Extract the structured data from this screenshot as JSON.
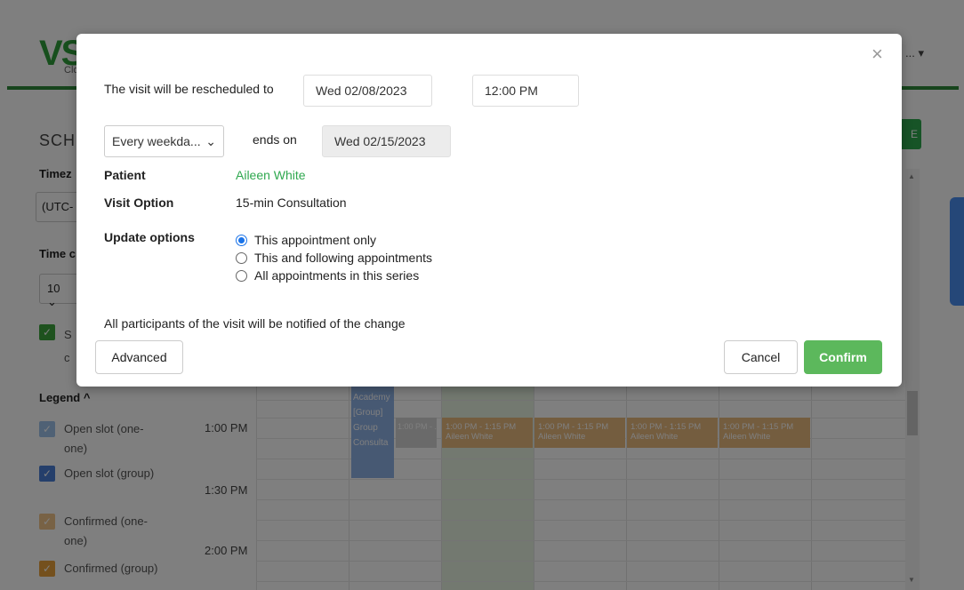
{
  "app": {
    "logo": "VS",
    "logo_sub": "Clou",
    "user_menu": "... ▾",
    "schedule_title": "SCHI",
    "new_button": "E",
    "timezone_label": "Timez",
    "timezone_value": "(UTC-",
    "time_label": "Time c",
    "time_value": "10 ⌄",
    "show_label_line1": "S",
    "show_label_line2": "c",
    "legend_title": "Legend ^",
    "legend": [
      {
        "label": "Open slot (one-one)",
        "color": "#9fc3ea"
      },
      {
        "label": "Open slot (group)",
        "color": "#4a7fd6"
      },
      {
        "label": "Confirmed (one-one)",
        "color": "#f0c48a"
      },
      {
        "label": "Confirmed (group)",
        "color": "#e8a13b"
      }
    ],
    "times": [
      "1:00 PM",
      "1:30 PM",
      "2:00 PM"
    ],
    "group_block": "VSee Academy [Group] Group Consulta",
    "grey_slot": "1:00 PM - ...",
    "appointments": [
      {
        "time": "1:00 PM - 1:15 PM",
        "name": "Aileen White"
      },
      {
        "time": "1:00 PM - 1:15 PM",
        "name": "Aileen White"
      },
      {
        "time": "1:00 PM - 1:15 PM",
        "name": "Aileen White"
      },
      {
        "time": "1:00 PM - 1:15 PM",
        "name": "Aileen White"
      }
    ]
  },
  "modal": {
    "reschedule_label": "The visit will be rescheduled to",
    "date": "Wed 02/08/2023",
    "time": "12:00 PM",
    "recurrence": "Every weekda...",
    "ends_on_label": "ends on",
    "end_date": "Wed 02/15/2023",
    "patient_label": "Patient",
    "patient_value": "Aileen White",
    "visit_option_label": "Visit Option",
    "visit_option_value": "15-min Consultation",
    "update_options_label": "Update options",
    "options": [
      {
        "label": "This appointment only",
        "selected": true
      },
      {
        "label": "This and following appointments",
        "selected": false
      },
      {
        "label": "All appointments in this series",
        "selected": false
      }
    ],
    "notice": "All participants of the visit will be notified of the change",
    "advanced_button": "Advanced",
    "cancel_button": "Cancel",
    "confirm_button": "Confirm",
    "close_icon": "×"
  }
}
